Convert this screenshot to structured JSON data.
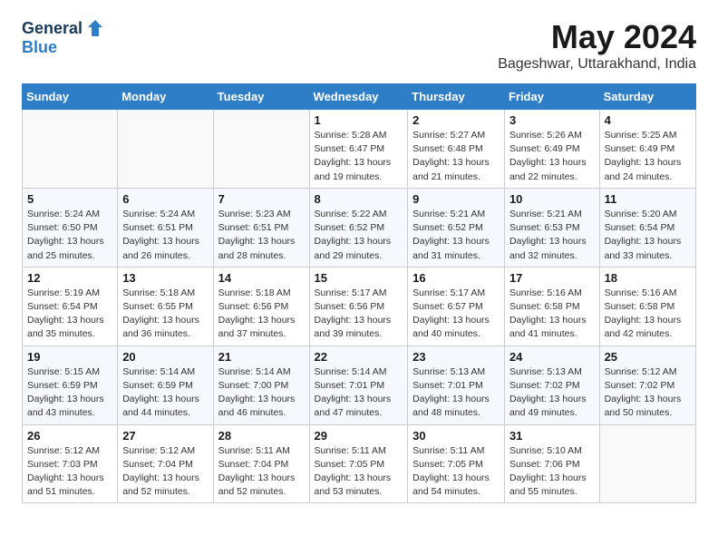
{
  "logo": {
    "general": "General",
    "blue": "Blue"
  },
  "title": "May 2024",
  "location": "Bageshwar, Uttarakhand, India",
  "weekdays": [
    "Sunday",
    "Monday",
    "Tuesday",
    "Wednesday",
    "Thursday",
    "Friday",
    "Saturday"
  ],
  "weeks": [
    [
      {
        "day": "",
        "info": ""
      },
      {
        "day": "",
        "info": ""
      },
      {
        "day": "",
        "info": ""
      },
      {
        "day": "1",
        "info": "Sunrise: 5:28 AM\nSunset: 6:47 PM\nDaylight: 13 hours\nand 19 minutes."
      },
      {
        "day": "2",
        "info": "Sunrise: 5:27 AM\nSunset: 6:48 PM\nDaylight: 13 hours\nand 21 minutes."
      },
      {
        "day": "3",
        "info": "Sunrise: 5:26 AM\nSunset: 6:49 PM\nDaylight: 13 hours\nand 22 minutes."
      },
      {
        "day": "4",
        "info": "Sunrise: 5:25 AM\nSunset: 6:49 PM\nDaylight: 13 hours\nand 24 minutes."
      }
    ],
    [
      {
        "day": "5",
        "info": "Sunrise: 5:24 AM\nSunset: 6:50 PM\nDaylight: 13 hours\nand 25 minutes."
      },
      {
        "day": "6",
        "info": "Sunrise: 5:24 AM\nSunset: 6:51 PM\nDaylight: 13 hours\nand 26 minutes."
      },
      {
        "day": "7",
        "info": "Sunrise: 5:23 AM\nSunset: 6:51 PM\nDaylight: 13 hours\nand 28 minutes."
      },
      {
        "day": "8",
        "info": "Sunrise: 5:22 AM\nSunset: 6:52 PM\nDaylight: 13 hours\nand 29 minutes."
      },
      {
        "day": "9",
        "info": "Sunrise: 5:21 AM\nSunset: 6:52 PM\nDaylight: 13 hours\nand 31 minutes."
      },
      {
        "day": "10",
        "info": "Sunrise: 5:21 AM\nSunset: 6:53 PM\nDaylight: 13 hours\nand 32 minutes."
      },
      {
        "day": "11",
        "info": "Sunrise: 5:20 AM\nSunset: 6:54 PM\nDaylight: 13 hours\nand 33 minutes."
      }
    ],
    [
      {
        "day": "12",
        "info": "Sunrise: 5:19 AM\nSunset: 6:54 PM\nDaylight: 13 hours\nand 35 minutes."
      },
      {
        "day": "13",
        "info": "Sunrise: 5:18 AM\nSunset: 6:55 PM\nDaylight: 13 hours\nand 36 minutes."
      },
      {
        "day": "14",
        "info": "Sunrise: 5:18 AM\nSunset: 6:56 PM\nDaylight: 13 hours\nand 37 minutes."
      },
      {
        "day": "15",
        "info": "Sunrise: 5:17 AM\nSunset: 6:56 PM\nDaylight: 13 hours\nand 39 minutes."
      },
      {
        "day": "16",
        "info": "Sunrise: 5:17 AM\nSunset: 6:57 PM\nDaylight: 13 hours\nand 40 minutes."
      },
      {
        "day": "17",
        "info": "Sunrise: 5:16 AM\nSunset: 6:58 PM\nDaylight: 13 hours\nand 41 minutes."
      },
      {
        "day": "18",
        "info": "Sunrise: 5:16 AM\nSunset: 6:58 PM\nDaylight: 13 hours\nand 42 minutes."
      }
    ],
    [
      {
        "day": "19",
        "info": "Sunrise: 5:15 AM\nSunset: 6:59 PM\nDaylight: 13 hours\nand 43 minutes."
      },
      {
        "day": "20",
        "info": "Sunrise: 5:14 AM\nSunset: 6:59 PM\nDaylight: 13 hours\nand 44 minutes."
      },
      {
        "day": "21",
        "info": "Sunrise: 5:14 AM\nSunset: 7:00 PM\nDaylight: 13 hours\nand 46 minutes."
      },
      {
        "day": "22",
        "info": "Sunrise: 5:14 AM\nSunset: 7:01 PM\nDaylight: 13 hours\nand 47 minutes."
      },
      {
        "day": "23",
        "info": "Sunrise: 5:13 AM\nSunset: 7:01 PM\nDaylight: 13 hours\nand 48 minutes."
      },
      {
        "day": "24",
        "info": "Sunrise: 5:13 AM\nSunset: 7:02 PM\nDaylight: 13 hours\nand 49 minutes."
      },
      {
        "day": "25",
        "info": "Sunrise: 5:12 AM\nSunset: 7:02 PM\nDaylight: 13 hours\nand 50 minutes."
      }
    ],
    [
      {
        "day": "26",
        "info": "Sunrise: 5:12 AM\nSunset: 7:03 PM\nDaylight: 13 hours\nand 51 minutes."
      },
      {
        "day": "27",
        "info": "Sunrise: 5:12 AM\nSunset: 7:04 PM\nDaylight: 13 hours\nand 52 minutes."
      },
      {
        "day": "28",
        "info": "Sunrise: 5:11 AM\nSunset: 7:04 PM\nDaylight: 13 hours\nand 52 minutes."
      },
      {
        "day": "29",
        "info": "Sunrise: 5:11 AM\nSunset: 7:05 PM\nDaylight: 13 hours\nand 53 minutes."
      },
      {
        "day": "30",
        "info": "Sunrise: 5:11 AM\nSunset: 7:05 PM\nDaylight: 13 hours\nand 54 minutes."
      },
      {
        "day": "31",
        "info": "Sunrise: 5:10 AM\nSunset: 7:06 PM\nDaylight: 13 hours\nand 55 minutes."
      },
      {
        "day": "",
        "info": ""
      }
    ]
  ]
}
